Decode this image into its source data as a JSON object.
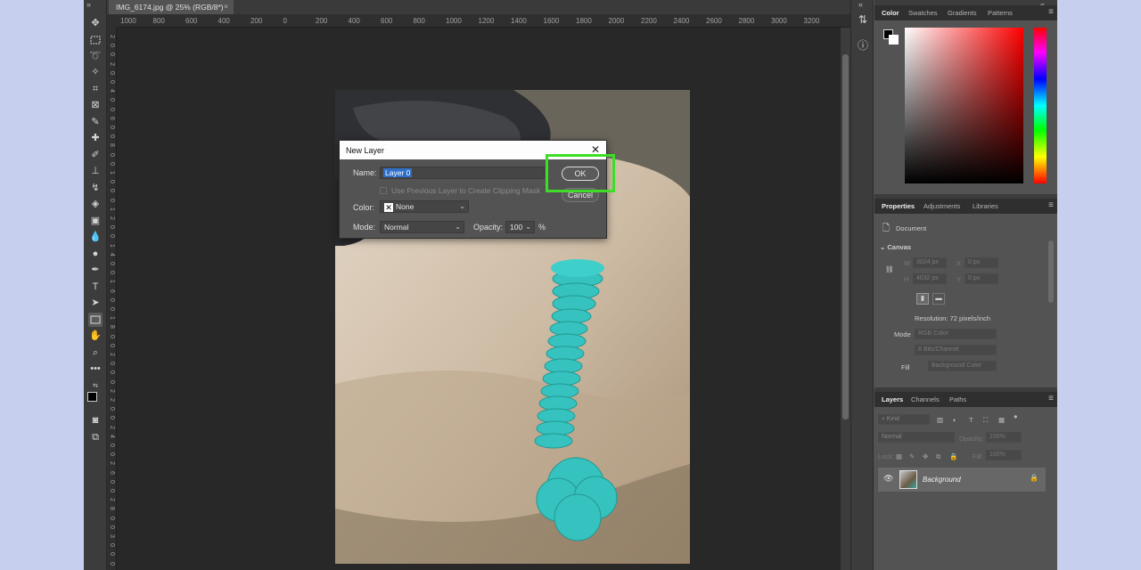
{
  "document_tab": {
    "title": "IMG_6174.jpg @ 25% (RGB/8*)",
    "close": "×"
  },
  "ruler_h_labels": [
    "1000",
    "800",
    "600",
    "400",
    "200",
    "0",
    "200",
    "400",
    "600",
    "800",
    "1000",
    "1200",
    "1400",
    "1600",
    "1800",
    "2000",
    "2200",
    "2400",
    "2600",
    "2800",
    "3000",
    "3200"
  ],
  "ruler_v_labels": [
    "2",
    "0",
    "0",
    "2",
    "0",
    "0",
    "4",
    "0",
    "0",
    "6",
    "0",
    "0",
    "8",
    "0",
    "0",
    "1",
    "0",
    "0",
    "0",
    "1",
    "2",
    "0",
    "0",
    "1",
    "4",
    "0",
    "0",
    "1",
    "6",
    "0",
    "0",
    "1",
    "8",
    "0",
    "0",
    "2",
    "0",
    "0",
    "0",
    "2",
    "2",
    "0",
    "0",
    "2",
    "4",
    "0",
    "0",
    "2",
    "6",
    "0",
    "0",
    "2",
    "8",
    "0",
    "0",
    "3",
    "0",
    "0",
    "0"
  ],
  "dialog": {
    "title": "New Layer",
    "name_label": "Name:",
    "name_value": "Layer 0",
    "clipping_label": "Use Previous Layer to Create Clipping Mask",
    "color_label": "Color:",
    "color_value": "None",
    "mode_label": "Mode:",
    "mode_value": "Normal",
    "opacity_label": "Opacity:",
    "opacity_value": "100",
    "opacity_unit": "%",
    "ok_label": "OK",
    "cancel_label": "Cancel"
  },
  "color_panel": {
    "tabs": [
      "Color",
      "Swatches",
      "Gradients",
      "Patterns"
    ]
  },
  "properties_panel": {
    "tabs": [
      "Properties",
      "Adjustments",
      "Libraries"
    ],
    "document_label": "Document",
    "canvas_label": "Canvas",
    "w_label": "W",
    "h_label": "H",
    "x_label": "X",
    "y_label": "Y",
    "w_value": "3024 px",
    "h_value": "4032 px",
    "x_value": "0 px",
    "y_value": "0 px",
    "resolution": "Resolution: 72 pixels/inch",
    "mode_label": "Mode",
    "mode_value": "RGB Color",
    "bit_depth": "8 Bits/Channel",
    "fill_label": "Fill",
    "fill_value": "Background Color"
  },
  "layers_panel": {
    "tabs": [
      "Layers",
      "Channels",
      "Paths"
    ],
    "search_placeholder": "Kind",
    "blend_mode": "Normal",
    "opacity_label": "Opacity:",
    "opacity_value": "100%",
    "lock_label": "Lock:",
    "fill_label": "Fill:",
    "fill_value": "100%",
    "layer_name": "Background"
  },
  "colors": {
    "highlight": "#3fdd28",
    "selection": "#2f6fc9",
    "rope": "#36c2be"
  }
}
